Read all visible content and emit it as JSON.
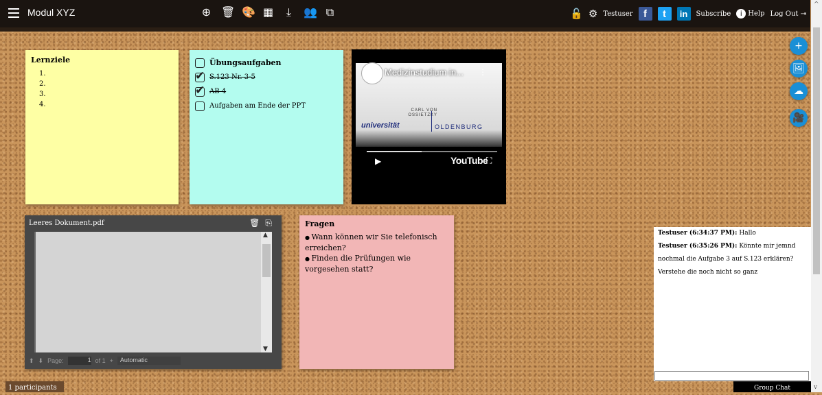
{
  "header": {
    "title": "Modul XYZ",
    "user": "Testuser",
    "subscribe": "Subscribe",
    "help": "Help",
    "logout": "Log Out"
  },
  "notes": {
    "yellow": {
      "title": "Lernziele",
      "items": [
        "1.",
        "2.",
        "3.",
        "4."
      ]
    },
    "cyan": {
      "title": "Übungsaufgaben",
      "tasks": [
        {
          "text": "S.123 Nr. 3-5",
          "done": true
        },
        {
          "text": "AB 4",
          "done": true
        },
        {
          "text": "Aufgaben am Ende der PPT",
          "done": false
        }
      ]
    },
    "pink": {
      "title": "Fragen",
      "items": [
        "Wann können wir Sie telefonisch erreichen?",
        "Finden die Prüfungen wie vorgesehen statt?"
      ]
    }
  },
  "video": {
    "title": "Medizinstudium in...",
    "uni_top": "CARL VON OSSIETZKY",
    "uni_main": "universität",
    "uni_city": "OLDENBURG",
    "brand": "YouTube"
  },
  "pdf": {
    "title": "Leeres Dokument.pdf",
    "page_label": "Page:",
    "page_value": "1",
    "of_label": "of 1",
    "zoom": "Automatic"
  },
  "chat": {
    "messages": [
      {
        "author": "Testuser (6:34:37 PM):",
        "text": "Hallo"
      },
      {
        "author": "Testuser (6:35:26 PM):",
        "text": "Könnte mir jemnd nochmal die Aufgabe 3 auf S.123 erklären? Verstehe die noch nicht so ganz"
      }
    ],
    "tab_label": "Group Chat"
  },
  "participants": "1 participants",
  "colors": {
    "yellow": "#feffa4",
    "cyan": "#b3fcef",
    "pink": "#f2b6b6",
    "accent": "#1a8fd6"
  }
}
